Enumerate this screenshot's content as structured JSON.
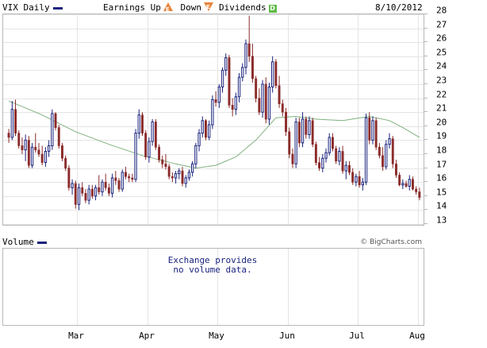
{
  "header": {
    "symbol_label": "VIX Daily",
    "earnings_label": "Earnings",
    "up_label": "Up",
    "up_icon": "E",
    "down_label": "Down",
    "down_icon": "E",
    "dividends_label": "Dividends",
    "dividends_icon": "D",
    "date": "8/10/2012"
  },
  "volume": {
    "label": "Volume",
    "note_line1": "Exchange provides",
    "note_line2": "no volume data."
  },
  "copyright": "© BigCharts.com",
  "colors": {
    "up": "#1a237e",
    "down": "#8b2b2b",
    "ma": "#7fb07f",
    "axis": "#b8b8b8"
  },
  "chart_data": {
    "type": "candlestick",
    "y_ticks": [
      13,
      14,
      15,
      16,
      17,
      18,
      19,
      20,
      21,
      22,
      23,
      24,
      25,
      26,
      27,
      28
    ],
    "ylim": [
      13,
      28
    ],
    "x_labels": [
      "Mar",
      "Apr",
      "May",
      "Jun",
      "Jul",
      "Aug"
    ],
    "grid": true,
    "series": [
      {
        "kind": "ohlc",
        "values": [
          [
            19.5,
            19.8,
            18.8,
            19.2
          ],
          [
            19.2,
            21.8,
            19.0,
            21.2
          ],
          [
            21.2,
            21.9,
            19.3,
            19.5
          ],
          [
            19.5,
            19.7,
            18.4,
            18.6
          ],
          [
            18.6,
            19.2,
            18.0,
            18.3
          ],
          [
            18.3,
            19.4,
            17.5,
            19.0
          ],
          [
            19.0,
            19.3,
            17.0,
            17.2
          ],
          [
            17.2,
            18.8,
            17.0,
            18.5
          ],
          [
            18.5,
            19.5,
            18.1,
            18.3
          ],
          [
            18.3,
            18.8,
            17.8,
            18.0
          ],
          [
            18.0,
            18.6,
            17.2,
            17.4
          ],
          [
            17.4,
            18.5,
            17.1,
            18.2
          ],
          [
            18.2,
            19.0,
            17.8,
            18.6
          ],
          [
            18.6,
            21.2,
            18.3,
            20.9
          ],
          [
            20.9,
            21.0,
            19.7,
            19.9
          ],
          [
            19.9,
            20.1,
            18.4,
            18.6
          ],
          [
            18.6,
            18.8,
            17.5,
            17.7
          ],
          [
            17.7,
            17.9,
            16.8,
            17.0
          ],
          [
            17.0,
            17.2,
            15.4,
            15.6
          ],
          [
            15.6,
            16.2,
            15.1,
            15.9
          ],
          [
            15.9,
            16.1,
            14.1,
            14.4
          ],
          [
            14.4,
            15.9,
            14.0,
            15.6
          ],
          [
            15.6,
            16.0,
            15.0,
            15.2
          ],
          [
            15.2,
            15.5,
            14.5,
            14.7
          ],
          [
            14.7,
            15.8,
            14.4,
            15.5
          ],
          [
            15.5,
            15.8,
            14.8,
            15.0
          ],
          [
            15.0,
            15.8,
            14.7,
            15.6
          ],
          [
            15.6,
            16.5,
            15.1,
            15.3
          ],
          [
            15.3,
            16.2,
            15.0,
            16.0
          ],
          [
            16.0,
            16.6,
            15.4,
            15.6
          ],
          [
            15.6,
            15.9,
            15.0,
            15.2
          ],
          [
            15.2,
            16.6,
            14.9,
            16.3
          ],
          [
            16.3,
            16.8,
            15.8,
            16.1
          ],
          [
            16.1,
            16.3,
            15.3,
            15.5
          ],
          [
            15.5,
            16.9,
            15.3,
            16.7
          ],
          [
            16.7,
            17.1,
            16.2,
            16.4
          ],
          [
            16.4,
            16.6,
            16.0,
            16.3
          ],
          [
            16.3,
            16.6,
            16.0,
            16.2
          ],
          [
            16.2,
            19.8,
            16.0,
            19.5
          ],
          [
            19.5,
            21.2,
            19.1,
            20.8
          ],
          [
            20.8,
            21.0,
            19.3,
            19.5
          ],
          [
            19.5,
            19.7,
            17.6,
            17.8
          ],
          [
            17.8,
            19.2,
            17.4,
            18.9
          ],
          [
            18.9,
            20.5,
            18.6,
            20.3
          ],
          [
            20.3,
            20.5,
            18.3,
            18.5
          ],
          [
            18.5,
            18.7,
            17.4,
            17.6
          ],
          [
            17.6,
            17.9,
            17.0,
            17.3
          ],
          [
            17.3,
            18.0,
            16.9,
            17.1
          ],
          [
            17.1,
            17.3,
            16.2,
            16.4
          ],
          [
            16.4,
            16.7,
            16.0,
            16.3
          ],
          [
            16.3,
            16.8,
            15.9,
            16.6
          ],
          [
            16.6,
            17.0,
            16.2,
            16.8
          ],
          [
            16.8,
            17.1,
            15.7,
            15.9
          ],
          [
            15.9,
            16.5,
            15.6,
            16.3
          ],
          [
            16.3,
            16.9,
            16.1,
            16.7
          ],
          [
            16.7,
            17.5,
            16.4,
            17.3
          ],
          [
            17.3,
            18.8,
            17.0,
            18.6
          ],
          [
            18.6,
            19.8,
            18.2,
            19.5
          ],
          [
            19.5,
            20.7,
            19.2,
            20.4
          ],
          [
            20.4,
            20.5,
            19.0,
            19.2
          ],
          [
            19.2,
            20.4,
            19.0,
            20.1
          ],
          [
            20.1,
            22.2,
            19.8,
            21.9
          ],
          [
            21.9,
            22.5,
            21.4,
            21.7
          ],
          [
            21.7,
            23.0,
            21.3,
            22.8
          ],
          [
            22.8,
            24.2,
            22.4,
            24.0
          ],
          [
            24.0,
            25.2,
            23.6,
            24.9
          ],
          [
            24.9,
            25.1,
            21.3,
            21.5
          ],
          [
            21.5,
            22.0,
            20.7,
            21.2
          ],
          [
            21.2,
            22.4,
            20.8,
            22.1
          ],
          [
            22.1,
            23.8,
            21.7,
            23.5
          ],
          [
            23.5,
            24.5,
            23.2,
            24.2
          ],
          [
            24.2,
            26.2,
            23.7,
            25.9
          ],
          [
            25.9,
            27.9,
            24.6,
            25.0
          ],
          [
            25.0,
            25.9,
            23.1,
            23.4
          ],
          [
            23.4,
            23.6,
            21.7,
            22.0
          ],
          [
            22.0,
            22.7,
            20.8,
            21.0
          ],
          [
            21.0,
            23.3,
            20.6,
            23.0
          ],
          [
            23.0,
            23.5,
            20.2,
            20.5
          ],
          [
            20.5,
            23.1,
            20.1,
            22.8
          ],
          [
            22.8,
            25.0,
            22.4,
            24.6
          ],
          [
            24.6,
            24.8,
            22.7,
            22.9
          ],
          [
            22.9,
            23.6,
            21.3,
            21.6
          ],
          [
            21.6,
            21.9,
            20.7,
            21.0
          ],
          [
            21.0,
            21.3,
            19.3,
            19.6
          ],
          [
            19.6,
            19.9,
            17.7,
            18.0
          ],
          [
            18.0,
            18.4,
            17.0,
            17.3
          ],
          [
            17.3,
            20.6,
            17.0,
            20.3
          ],
          [
            20.3,
            20.6,
            18.5,
            18.8
          ],
          [
            18.8,
            21.0,
            18.5,
            20.5
          ],
          [
            20.5,
            20.7,
            19.1,
            19.4
          ],
          [
            19.4,
            20.7,
            19.1,
            20.4
          ],
          [
            20.4,
            20.6,
            18.5,
            18.7
          ],
          [
            18.7,
            18.9,
            17.2,
            17.4
          ],
          [
            17.4,
            17.8,
            16.8,
            17.0
          ],
          [
            17.0,
            18.0,
            16.7,
            17.7
          ],
          [
            17.7,
            18.4,
            17.4,
            18.1
          ],
          [
            18.1,
            19.5,
            17.9,
            19.2
          ],
          [
            19.2,
            19.5,
            18.2,
            18.4
          ],
          [
            18.4,
            18.6,
            17.3,
            17.5
          ],
          [
            17.5,
            18.5,
            17.2,
            18.2
          ],
          [
            18.2,
            18.6,
            16.6,
            16.8
          ],
          [
            16.8,
            17.5,
            16.2,
            17.2
          ],
          [
            17.2,
            17.5,
            16.5,
            16.7
          ],
          [
            16.7,
            17.0,
            15.8,
            16.0
          ],
          [
            16.0,
            16.6,
            15.7,
            16.4
          ],
          [
            16.4,
            16.8,
            15.6,
            15.8
          ],
          [
            15.8,
            16.3,
            15.4,
            16.0
          ],
          [
            16.0,
            20.9,
            15.8,
            20.6
          ],
          [
            20.6,
            21.0,
            18.7,
            19.0
          ],
          [
            19.0,
            20.7,
            18.7,
            20.4
          ],
          [
            20.4,
            20.6,
            18.3,
            18.5
          ],
          [
            18.5,
            18.8,
            17.7,
            17.9
          ],
          [
            17.9,
            18.5,
            16.8,
            17.1
          ],
          [
            17.1,
            19.0,
            16.9,
            18.7
          ],
          [
            18.7,
            19.5,
            18.4,
            19.1
          ],
          [
            19.1,
            19.3,
            17.0,
            17.3
          ],
          [
            17.3,
            17.6,
            16.3,
            16.5
          ],
          [
            16.5,
            16.7,
            15.7,
            15.8
          ],
          [
            15.8,
            16.2,
            15.5,
            15.9
          ],
          [
            15.9,
            16.1,
            15.6,
            15.7
          ],
          [
            15.7,
            16.5,
            15.4,
            16.2
          ],
          [
            16.2,
            16.4,
            15.4,
            15.5
          ],
          [
            15.5,
            15.7,
            15.1,
            15.3
          ],
          [
            15.3,
            15.6,
            14.7,
            14.9
          ]
        ]
      },
      {
        "kind": "moving-average",
        "x": [
          0,
          10,
          20,
          30,
          40,
          50,
          56,
          62,
          68,
          74,
          80,
          86,
          92,
          100,
          108,
          114,
          118,
          123
        ],
        "values": [
          21.8,
          20.8,
          19.6,
          18.7,
          17.9,
          17.3,
          17.0,
          17.2,
          17.8,
          19.0,
          20.6,
          20.7,
          20.5,
          20.4,
          20.7,
          20.4,
          19.9,
          19.2
        ]
      }
    ]
  }
}
